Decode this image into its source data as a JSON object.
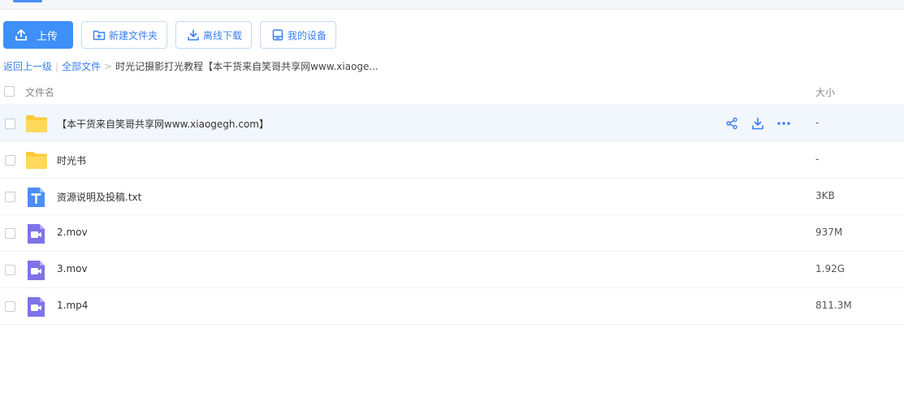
{
  "toolbar": {
    "upload_label": "上传",
    "new_folder_label": "新建文件夹",
    "offline_download_label": "离线下载",
    "my_devices_label": "我的设备"
  },
  "breadcrumb": {
    "back": "返回上一级",
    "all_files": "全部文件",
    "current": "时光记摄影打光教程【本干货来自笑哥共享网www.xiaoge..."
  },
  "table": {
    "col_name": "文件名",
    "col_size": "大小"
  },
  "files": [
    {
      "name": "【本干货来自笑哥共享网www.xiaogegh.com】",
      "size": "-",
      "type": "folder"
    },
    {
      "name": "时光书",
      "size": "-",
      "type": "folder"
    },
    {
      "name": "资源说明及投稿.txt",
      "size": "3KB",
      "type": "text"
    },
    {
      "name": "2.mov",
      "size": "937M",
      "type": "video"
    },
    {
      "name": "3.mov",
      "size": "1.92G",
      "type": "video"
    },
    {
      "name": "1.mp4",
      "size": "811.3M",
      "type": "video"
    }
  ],
  "colors": {
    "accent": "#3e8ff7",
    "folder": "#ffd24d",
    "text_file": "#4b8df8",
    "video_file": "#7d72e8"
  }
}
